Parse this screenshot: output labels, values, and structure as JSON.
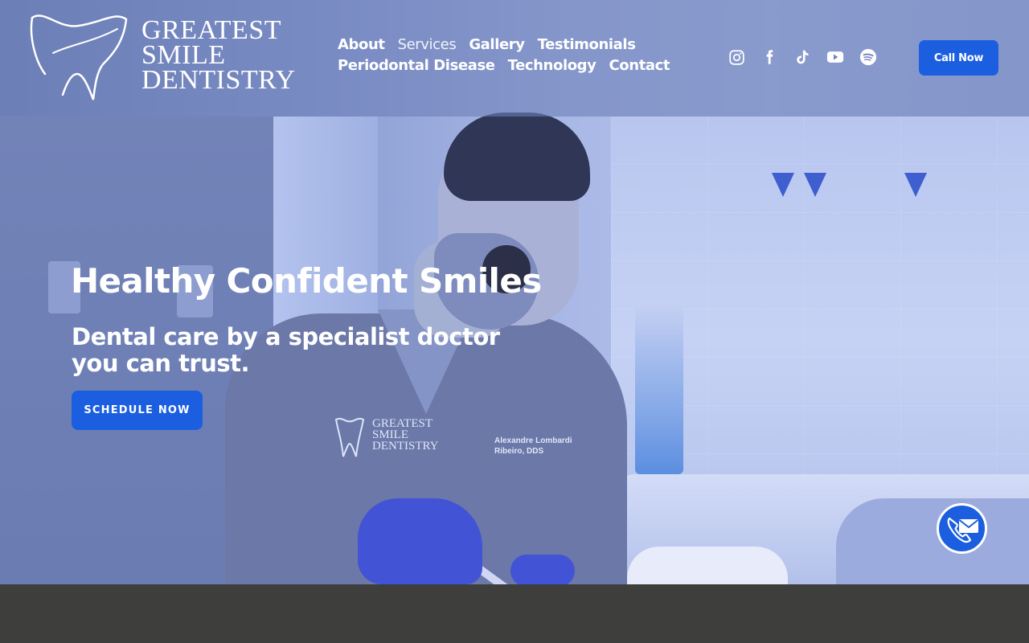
{
  "brand": {
    "name_lines": [
      "GREATEST",
      "SMILE",
      "DENTISTRY"
    ]
  },
  "nav": {
    "row1": [
      "About",
      "Services",
      "Gallery",
      "Testimonials"
    ],
    "row2": [
      "Periodontal Disease",
      "Technology",
      "Contact"
    ],
    "active": "Services"
  },
  "socials": [
    "instagram-icon",
    "facebook-icon",
    "tiktok-icon",
    "youtube-icon",
    "spotify-icon"
  ],
  "header": {
    "call_label": "Call Now"
  },
  "hero": {
    "title": "Healthy Confident Smiles",
    "subtitle_line1": "Dental care by a specialist doctor",
    "subtitle_line2": "you can trust.",
    "cta_label": "SCHEDULE NOW"
  },
  "scrubs": {
    "logo_lines": [
      "GREATEST",
      "SMILE",
      "DENTISTRY"
    ],
    "name_lines": [
      "Alexandre Lombardi",
      "Ribeiro, DDS"
    ]
  },
  "colors": {
    "accent": "#1b5fe0",
    "overlay": "#6c7eb8",
    "footer": "#3e3e3c"
  }
}
